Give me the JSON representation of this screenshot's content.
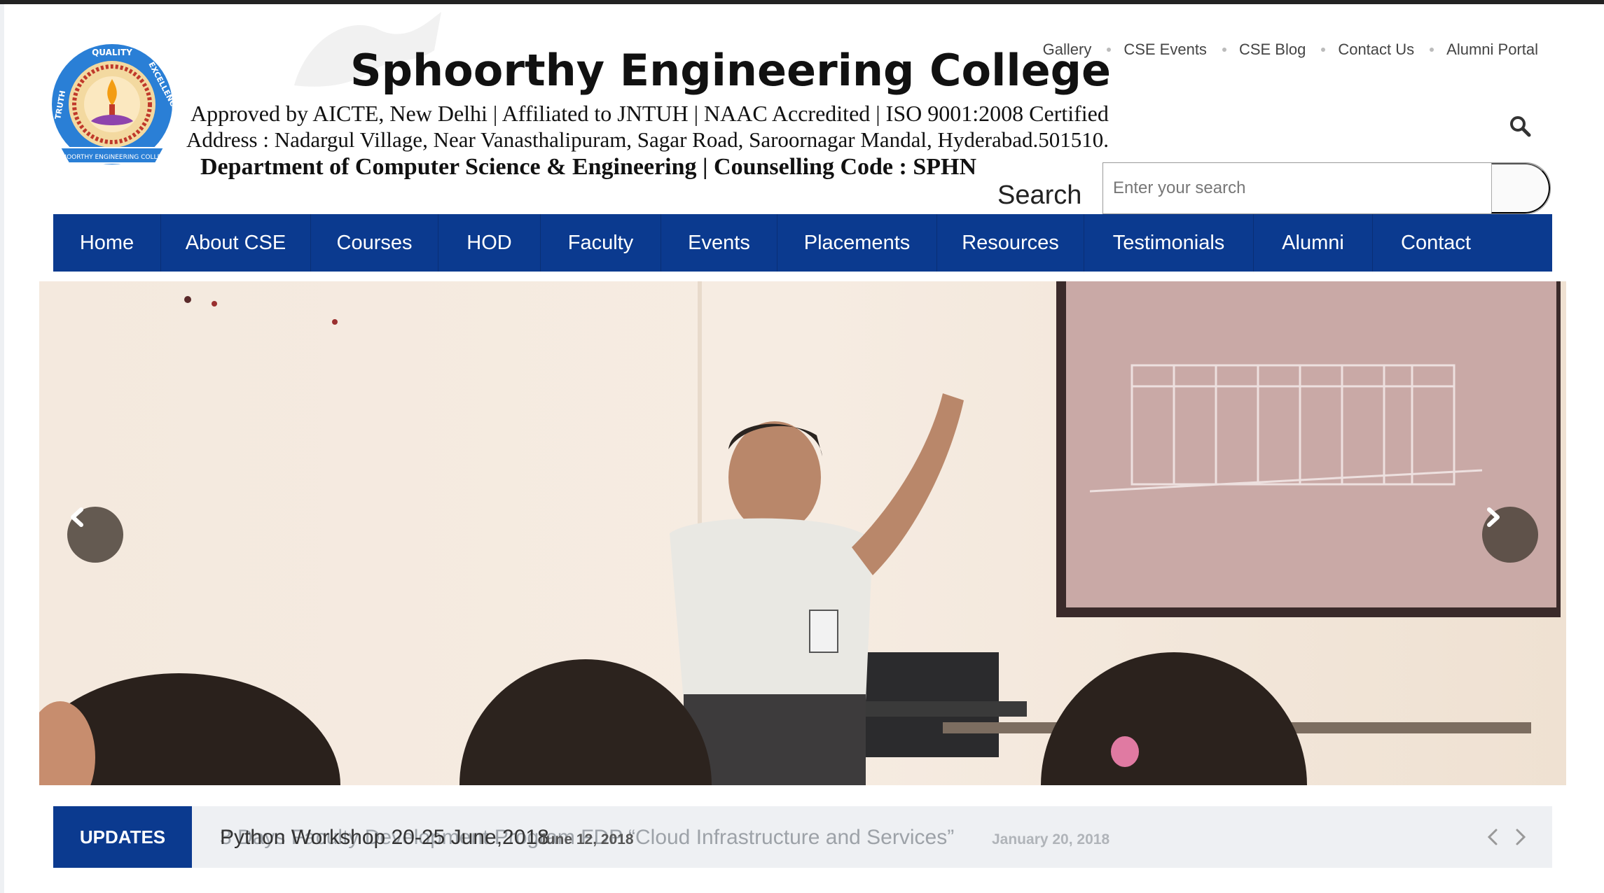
{
  "header": {
    "college_name": "Sphoorthy Engineering College",
    "approval_line": "Approved by AICTE, New Delhi | Affiliated to JNTUH | NAAC Accredited | ISO 9001:2008 Certified",
    "address_line": "Address : Nadargul Village, Near Vanasthalipuram, Sagar Road, Saroornagar Mandal, Hyderabad.501510.",
    "department_line": "Department of Computer Science & Engineering | Counselling Code : SPHN",
    "logo": {
      "icon": "college-seal-icon",
      "ring_top": "QUALITY",
      "ring_left": "TRUTH",
      "ring_right": "EXCELLENCE",
      "ribbon": "SPHOORTHY ENGINEERING COLLEGE"
    }
  },
  "top_links": [
    "Gallery",
    "CSE Events",
    "CSE Blog",
    "Contact Us",
    "Alumni Portal"
  ],
  "search": {
    "label": "Search",
    "placeholder": "Enter your search",
    "icon": "search-icon"
  },
  "nav": {
    "items": [
      "Home",
      "About CSE",
      "Courses",
      "HOD",
      "Faculty",
      "Events",
      "Placements",
      "Resources",
      "Testimonials",
      "Alumni",
      "Contact"
    ]
  },
  "slider": {
    "prev_icon": "chevron-left-icon",
    "next_icon": "chevron-right-icon"
  },
  "updates": {
    "label": "UPDATES",
    "current": {
      "text": "Python Workshop 20-25 June,2018",
      "date": "June 12, 2018"
    },
    "previous": {
      "text": "3 Days Faculty Development Program FDP “Cloud Infrastructure and Services”",
      "date": "January 20, 2018"
    }
  },
  "colors": {
    "nav_bg": "#0b3a8f",
    "updates_label_bg": "#0b3a8f",
    "updates_bar_bg": "#eef0f3",
    "top_strip": "#222222"
  }
}
